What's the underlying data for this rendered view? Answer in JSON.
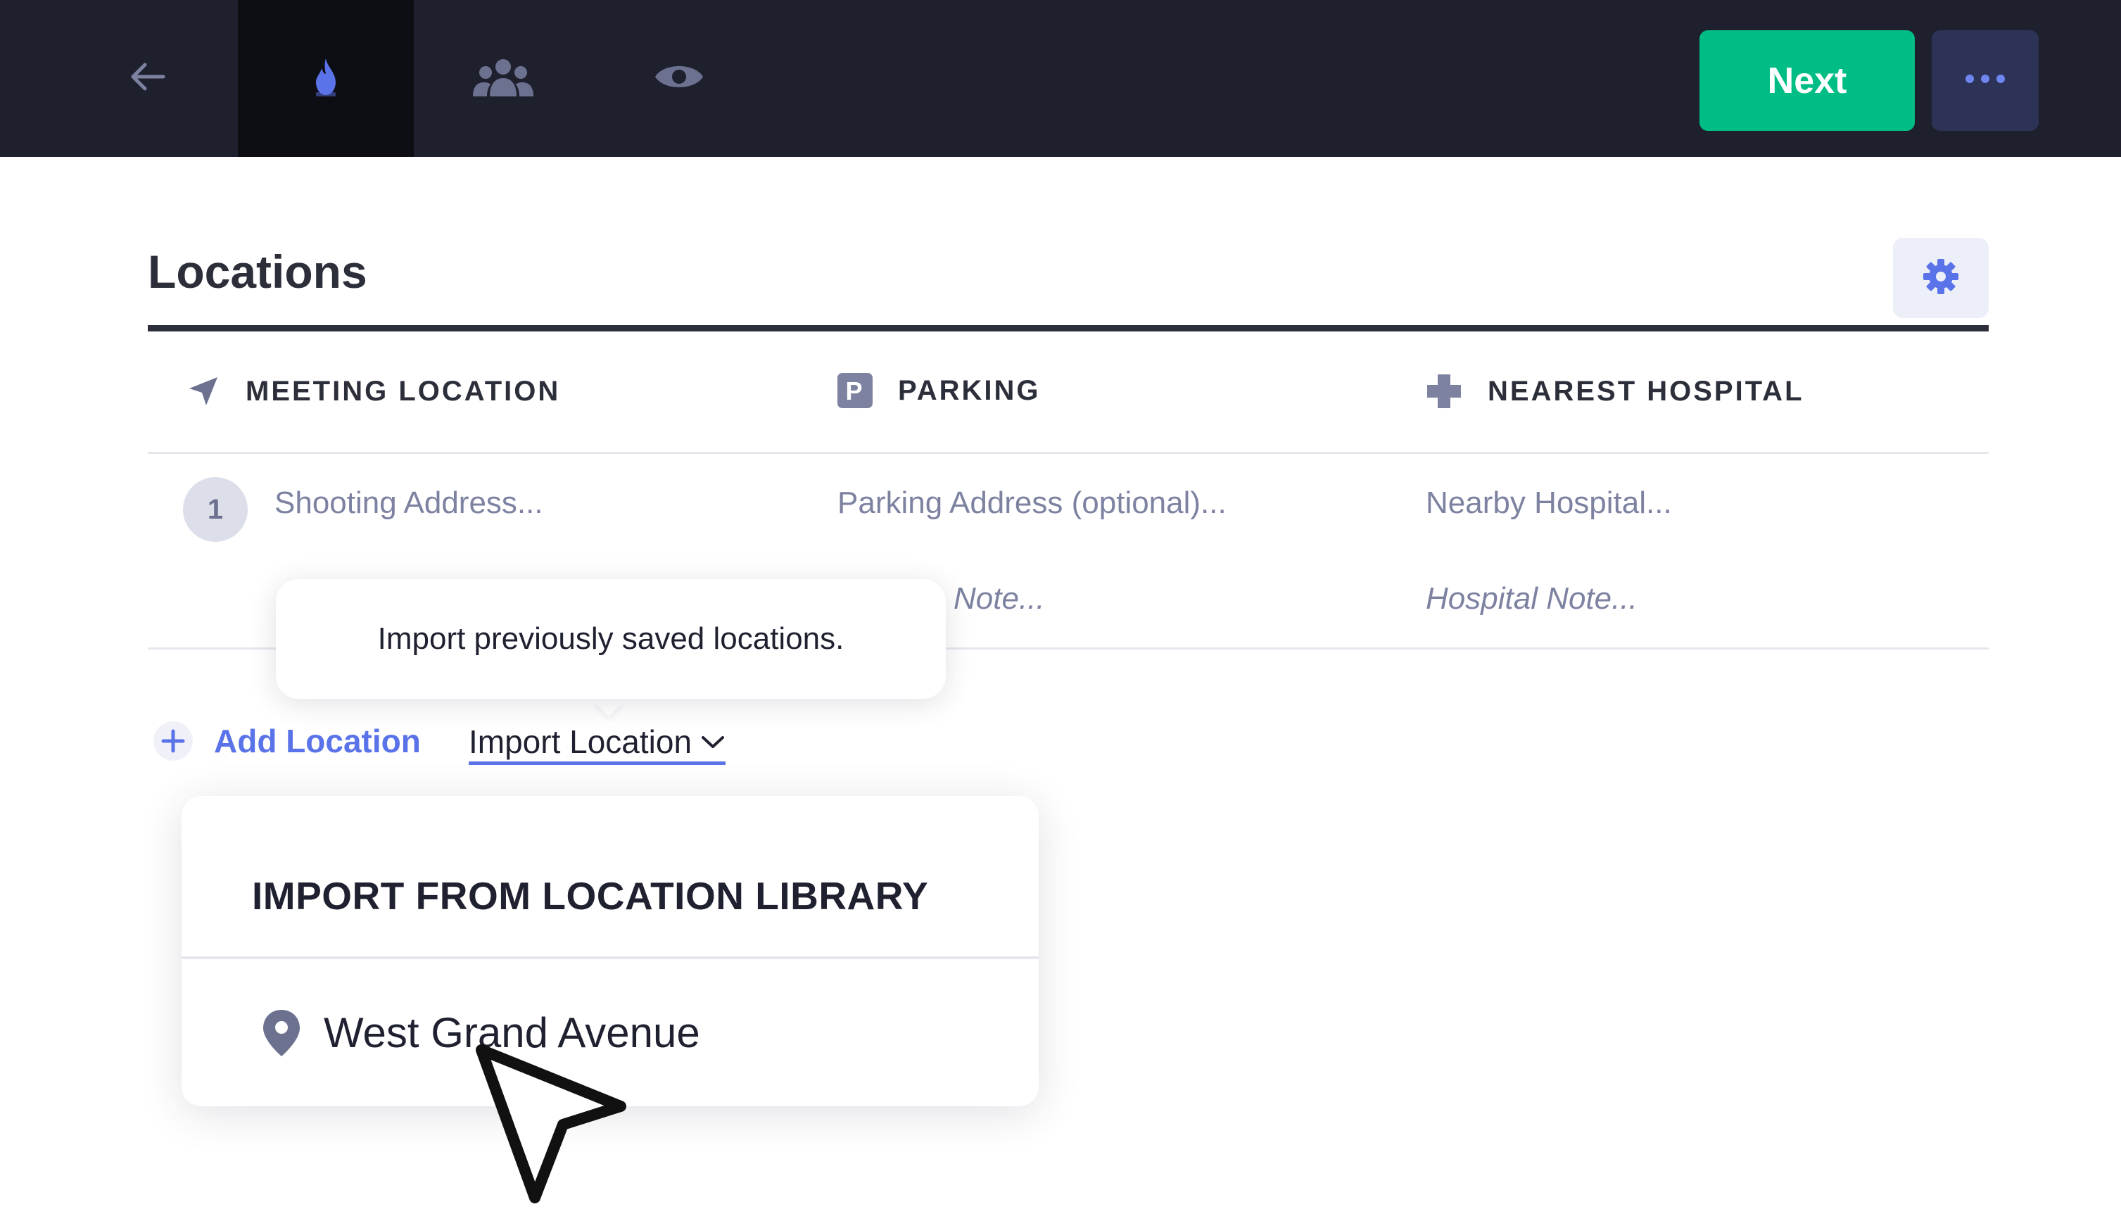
{
  "topbar": {
    "nav": [
      {
        "icon": "back-arrow-icon",
        "active": false
      },
      {
        "icon": "flame-icon",
        "active": true
      },
      {
        "icon": "people-icon",
        "active": false
      },
      {
        "icon": "eye-icon",
        "active": false
      }
    ],
    "next_label": "Next",
    "more_icon": "more-dots-icon"
  },
  "colors": {
    "topbar_bg": "#1f202e",
    "accent": "#5b73e8",
    "next_bg": "#00bd85",
    "muted_text": "#7d82a1"
  },
  "header": {
    "title": "Locations",
    "settings_icon": "gear-icon"
  },
  "columns": [
    {
      "label": "MEETING LOCATION",
      "icon": "navigation-arrow-icon"
    },
    {
      "label": "PARKING",
      "icon": "parking-icon"
    },
    {
      "label": "NEAREST HOSPITAL",
      "icon": "medical-cross-icon"
    }
  ],
  "rows": [
    {
      "number": "1",
      "shooting_address_placeholder": "Shooting Address...",
      "parking_address_placeholder": "Parking Address (optional)...",
      "hospital_placeholder": "Nearby Hospital...",
      "parking_note_placeholder": "Note...",
      "hospital_note_placeholder": "Hospital Note..."
    }
  ],
  "tooltip": {
    "text": "Import previously saved locations."
  },
  "actions": {
    "add_location": "Add Location",
    "import_location": "Import Location"
  },
  "dropdown": {
    "title": "IMPORT FROM LOCATION LIBRARY",
    "items": [
      {
        "label": "West Grand Avenue",
        "icon": "map-pin-icon"
      }
    ]
  }
}
